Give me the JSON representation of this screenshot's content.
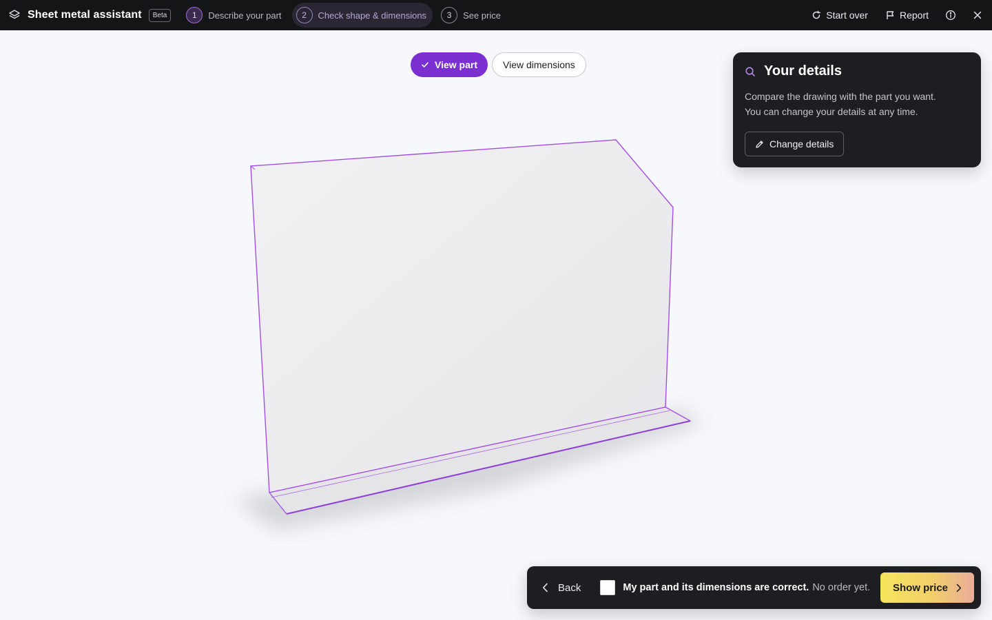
{
  "app": {
    "title": "Sheet metal assistant",
    "badge": "Beta"
  },
  "steps": [
    {
      "number": "1",
      "label": "Describe your part"
    },
    {
      "number": "2",
      "label": "Check shape & dimensions"
    },
    {
      "number": "3",
      "label": "See price"
    }
  ],
  "top_actions": {
    "start_over": "Start over",
    "report": "Report"
  },
  "view_toggle": {
    "view_part": "View part",
    "view_dimensions": "View dimensions"
  },
  "details": {
    "title": "Your details",
    "text_line1": "Compare the drawing with the part you want.",
    "text_line2": "You can change your details at any time.",
    "change_button": "Change details"
  },
  "confirm": {
    "back": "Back",
    "statement": "My part and its dimensions are correct.",
    "note": "No order yet.",
    "show_price": "Show price"
  },
  "colors": {
    "accent": "#7b2fd0",
    "outline": "#a24ee6",
    "topbar": "#141517"
  }
}
